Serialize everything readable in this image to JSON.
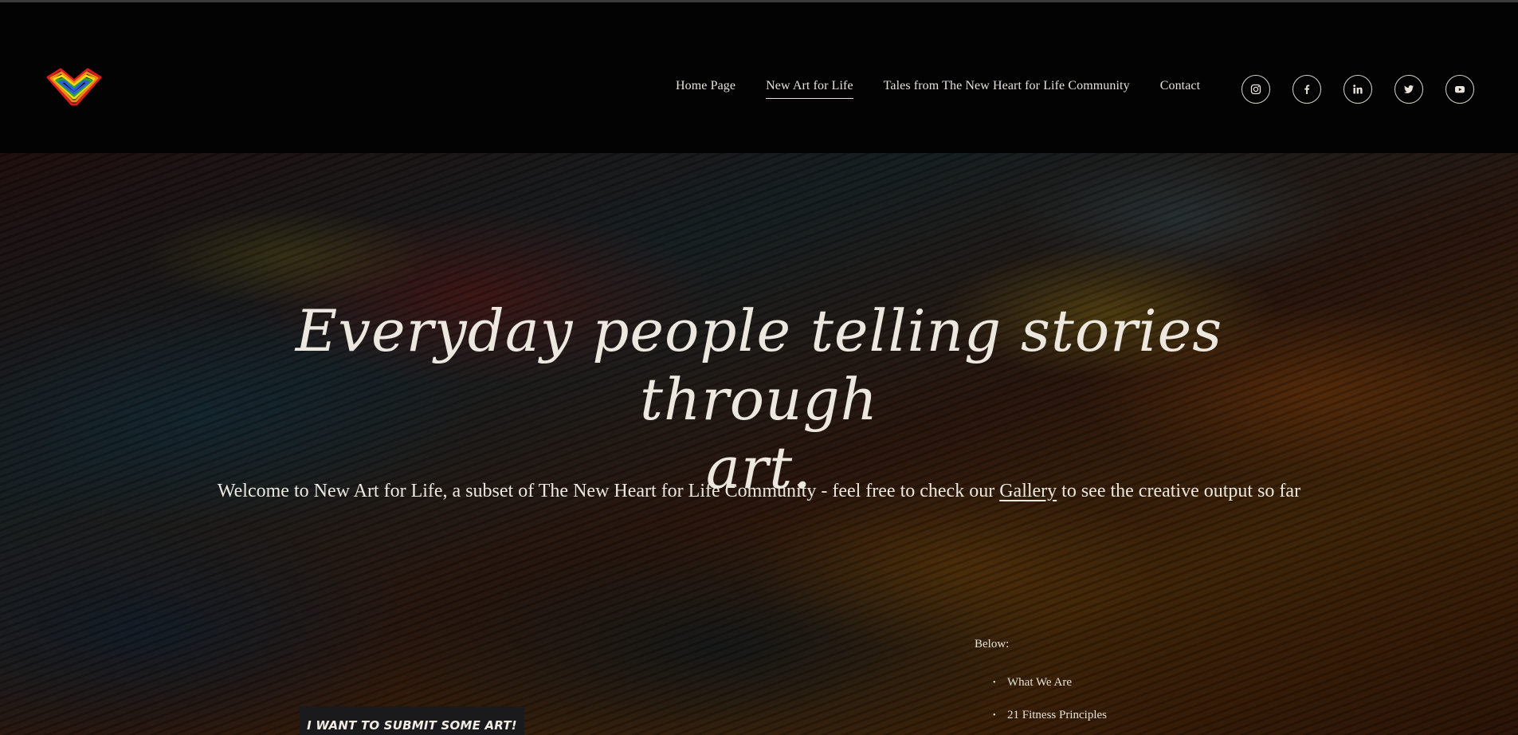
{
  "nav": {
    "links": [
      {
        "label": "Home Page"
      },
      {
        "label": "New Art for Life"
      },
      {
        "label": "Tales from The New Heart for Life Community"
      },
      {
        "label": "Contact"
      }
    ],
    "active_index": 1
  },
  "socials": [
    {
      "icon": "instagram-icon"
    },
    {
      "icon": "facebook-icon"
    },
    {
      "icon": "linkedin-icon"
    },
    {
      "icon": "twitter-icon"
    },
    {
      "icon": "youtube-icon"
    }
  ],
  "hero": {
    "headline_line1": "Everyday people telling stories through",
    "headline_line2": "art.",
    "intro_before": "Welcome to New Art for Life, a subset of The New Heart for Life Community - feel free to check our ",
    "intro_link": "Gallery",
    "intro_after": " to see the creative output so far",
    "submit_button": "I want to submit some art!",
    "below_label": "Below:",
    "below_items": [
      "What We Are",
      "21 Fitness Principles"
    ]
  },
  "colors": {
    "header_bg": "#030303",
    "text": "#ece8e0",
    "button_bg": "#1a1a1c"
  }
}
